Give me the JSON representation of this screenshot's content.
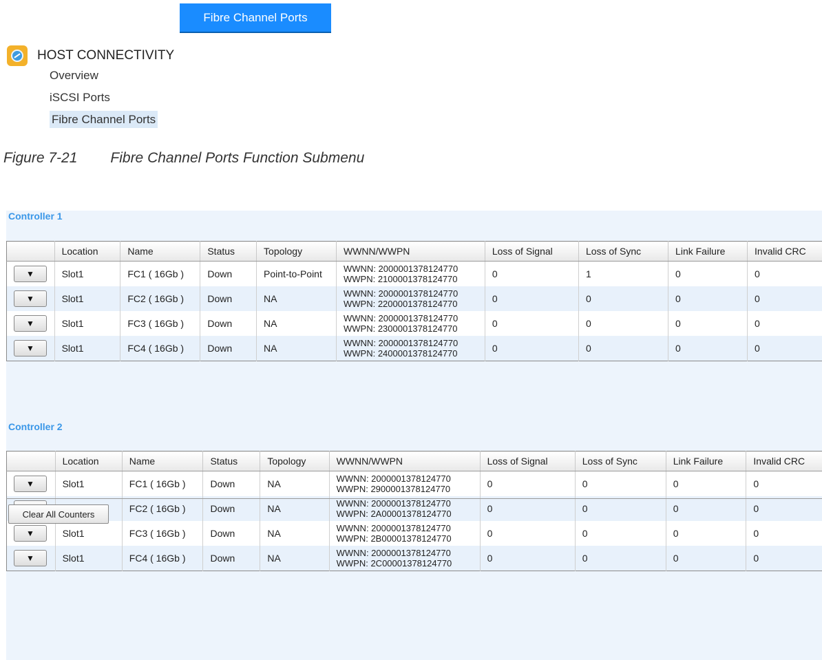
{
  "top_button": "Fibre Channel Ports",
  "menu": {
    "title": "HOST CONNECTIVITY",
    "items": [
      "Overview",
      "iSCSI Ports",
      "Fibre Channel Ports"
    ]
  },
  "caption": {
    "number": "Figure 7-21",
    "text": "Fibre Channel Ports Function Submenu"
  },
  "columns": [
    "",
    "Location",
    "Name",
    "Status",
    "Topology",
    "WWNN/WWPN",
    "Loss of Signal",
    "Loss of Sync",
    "Link Failure",
    "Invalid CRC"
  ],
  "row_button_glyph": "▼",
  "controllers": [
    {
      "title": "Controller 1",
      "rows": [
        {
          "location": "Slot1",
          "name": "FC1 ( 16Gb )",
          "status": "Down",
          "topology": "Point-to-Point",
          "wwnn": "WWNN: 2000001378124770",
          "wwpn": "WWPN: 2100001378124770",
          "loss_signal": "0",
          "loss_sync": "1",
          "link_failure": "0",
          "invalid_crc": "0"
        },
        {
          "location": "Slot1",
          "name": "FC2 ( 16Gb )",
          "status": "Down",
          "topology": "NA",
          "wwnn": "WWNN: 2000001378124770",
          "wwpn": "WWPN: 2200001378124770",
          "loss_signal": "0",
          "loss_sync": "0",
          "link_failure": "0",
          "invalid_crc": "0"
        },
        {
          "location": "Slot1",
          "name": "FC3 ( 16Gb )",
          "status": "Down",
          "topology": "NA",
          "wwnn": "WWNN: 2000001378124770",
          "wwpn": "WWPN: 2300001378124770",
          "loss_signal": "0",
          "loss_sync": "0",
          "link_failure": "0",
          "invalid_crc": "0"
        },
        {
          "location": "Slot1",
          "name": "FC4 ( 16Gb )",
          "status": "Down",
          "topology": "NA",
          "wwnn": "WWNN: 2000001378124770",
          "wwpn": "WWPN: 2400001378124770",
          "loss_signal": "0",
          "loss_sync": "0",
          "link_failure": "0",
          "invalid_crc": "0"
        }
      ]
    },
    {
      "title": "Controller 2",
      "rows": [
        {
          "location": "Slot1",
          "name": "FC1 ( 16Gb )",
          "status": "Down",
          "topology": "NA",
          "wwnn": "WWNN: 2000001378124770",
          "wwpn": "WWPN: 2900001378124770",
          "loss_signal": "0",
          "loss_sync": "0",
          "link_failure": "0",
          "invalid_crc": "0"
        },
        {
          "location": "Slot1",
          "name": "FC2 ( 16Gb )",
          "status": "Down",
          "topology": "NA",
          "wwnn": "WWNN: 2000001378124770",
          "wwpn": "WWPN: 2A00001378124770",
          "loss_signal": "0",
          "loss_sync": "0",
          "link_failure": "0",
          "invalid_crc": "0"
        },
        {
          "location": "Slot1",
          "name": "FC3 ( 16Gb )",
          "status": "Down",
          "topology": "NA",
          "wwnn": "WWNN: 2000001378124770",
          "wwpn": "WWPN: 2B00001378124770",
          "loss_signal": "0",
          "loss_sync": "0",
          "link_failure": "0",
          "invalid_crc": "0"
        },
        {
          "location": "Slot1",
          "name": "FC4 ( 16Gb )",
          "status": "Down",
          "topology": "NA",
          "wwnn": "WWNN: 2000001378124770",
          "wwpn": "WWPN: 2C00001378124770",
          "loss_signal": "0",
          "loss_sync": "0",
          "link_failure": "0",
          "invalid_crc": "0"
        }
      ]
    }
  ],
  "clear_button": "Clear All Counters",
  "colors": {
    "accent": "#1a8cff",
    "controller_title": "#3a97e8",
    "panel_bg": "#edf4fc",
    "row_alt": "#e8f1fb",
    "menu_selected": "#dbe9f7"
  }
}
